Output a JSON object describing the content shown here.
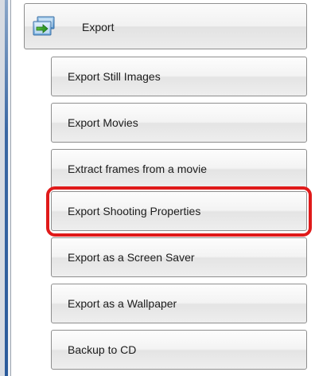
{
  "category": {
    "label": "Export",
    "icon": "export-folder-icon"
  },
  "items": [
    {
      "label": "Export Still Images"
    },
    {
      "label": "Export Movies"
    },
    {
      "label": "Extract frames from a movie"
    },
    {
      "label": "Export Shooting Properties",
      "highlighted": true
    },
    {
      "label": "Export as a Screen Saver"
    },
    {
      "label": "Export as a Wallpaper"
    },
    {
      "label": "Backup to CD"
    }
  ],
  "colors": {
    "highlight": "#e01a1a",
    "sidebar_edge": "#2a5a9b"
  }
}
